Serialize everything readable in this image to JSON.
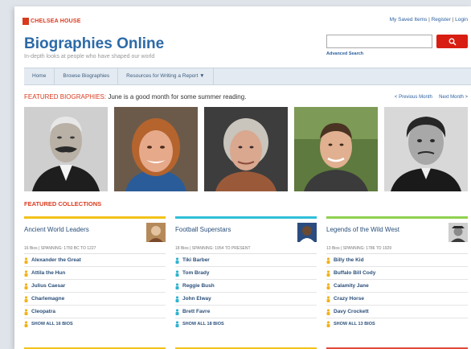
{
  "brand": {
    "logo_text": "CHELSEA HOUSE",
    "accent": "#d93a1f"
  },
  "header": {
    "top_links": [
      "My Saved Items",
      "Register",
      "Login"
    ],
    "site_title": "Biographies Online",
    "site_subtitle": "In-depth looks at people who have shaped our world",
    "search_placeholder": "",
    "search_icon": "magnifier-icon",
    "advanced_search_label": "Advanced Search"
  },
  "nav": {
    "items": [
      "Home",
      "Browse Biographies",
      "Resources for Writing a Report ▼"
    ]
  },
  "featured": {
    "label": "FEATURED BIOGRAPHIES:",
    "tagline": "June is a good month for some summer reading.",
    "prev_label": "< Previous Month",
    "next_label": "Next Month >"
  },
  "collections": {
    "heading": "FEATURED COLLECTIONS",
    "columns": [
      {
        "title": "Ancient World Leaders",
        "meta": "16 Bios | SPANNING: 1750 BC TO 1227",
        "items": [
          "Alexander the Great",
          "Attila the Hun",
          "Julius Caesar",
          "Charlemagne",
          "Cleopatra"
        ],
        "show_all": "SHOW ALL 16 BIOS",
        "accent": "#f2c21a",
        "bottom_accent": "#f2c21a"
      },
      {
        "title": "Football Superstars",
        "meta": "18 Bios | SPANNING: 1954 TO PRESENT",
        "items": [
          "Tiki Barber",
          "Tom Brady",
          "Reggie Bush",
          "John Elway",
          "Brett Favre"
        ],
        "show_all": "SHOW ALL 18 BIOS",
        "accent": "#2fc0d8",
        "bottom_accent": "#f2c21a"
      },
      {
        "title": "Legends of the Wild West",
        "meta": "13 Bios | SPANNING: 1786 TO 1929",
        "items": [
          "Billy the Kid",
          "Buffalo Bill Cody",
          "Calamity Jane",
          "Crazy Horse",
          "Davy Crockett"
        ],
        "show_all": "SHOW ALL 13 BIOS",
        "accent": "#8fd14f",
        "bottom_accent": "#e04a3a"
      }
    ]
  }
}
